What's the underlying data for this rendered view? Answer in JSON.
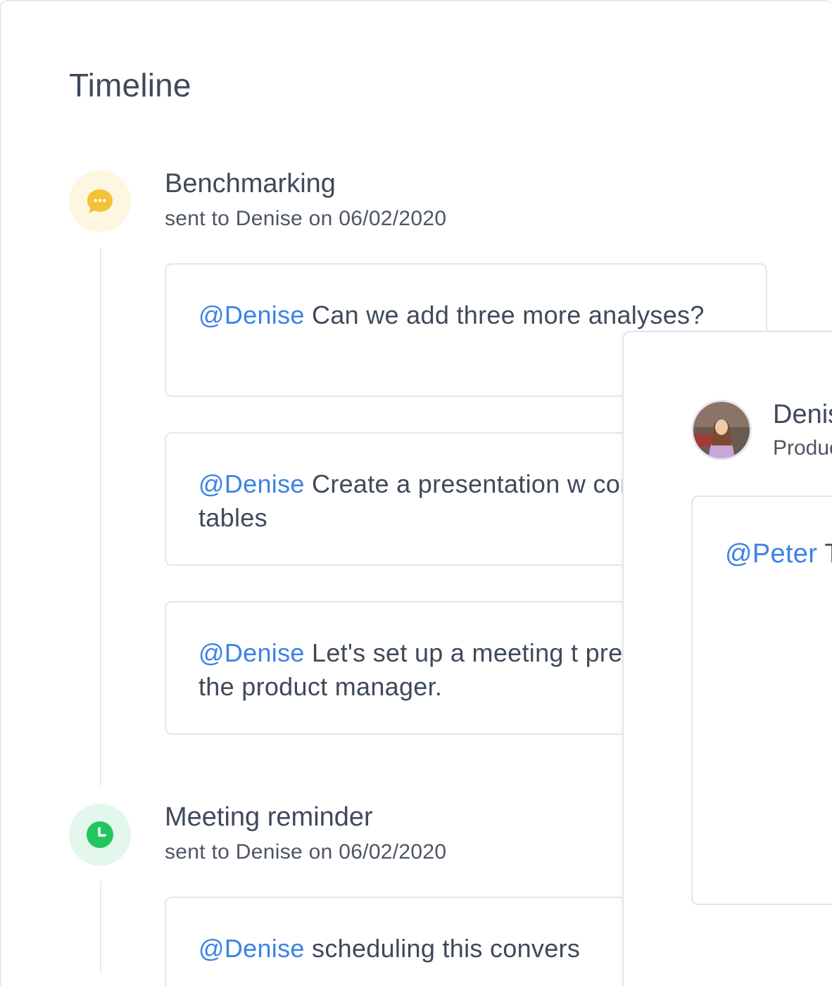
{
  "header": {
    "title": "Timeline"
  },
  "events": [
    {
      "title": "Benchmarking",
      "subtitle": "sent to Denise on 06/02/2020",
      "icon": "chat-bubble-icon",
      "icon_color": "#f3c236",
      "comments": [
        {
          "mention": "@Denise",
          "text": " Can we add three more analyses?"
        },
        {
          "mention": "@Denise",
          "text": " Create a presentation w comparison tables"
        },
        {
          "mention": "@Denise",
          "text": " Let's set up a meeting t present to the product manager."
        }
      ]
    },
    {
      "title": "Meeting reminder",
      "subtitle": "sent to Denise on 06/02/2020",
      "icon": "clock-icon",
      "icon_color": "#22c55e",
      "comments": [
        {
          "mention": "@Denise",
          "text": " scheduling this convers"
        }
      ]
    }
  ],
  "profile_panel": {
    "name": "Denis",
    "role": "Produc",
    "reply": {
      "mention": "@Peter",
      "text": " T I will revi new proj"
    }
  },
  "colors": {
    "mention": "#3c82e6",
    "text": "#3f4a59",
    "border": "#e3e6ea"
  }
}
